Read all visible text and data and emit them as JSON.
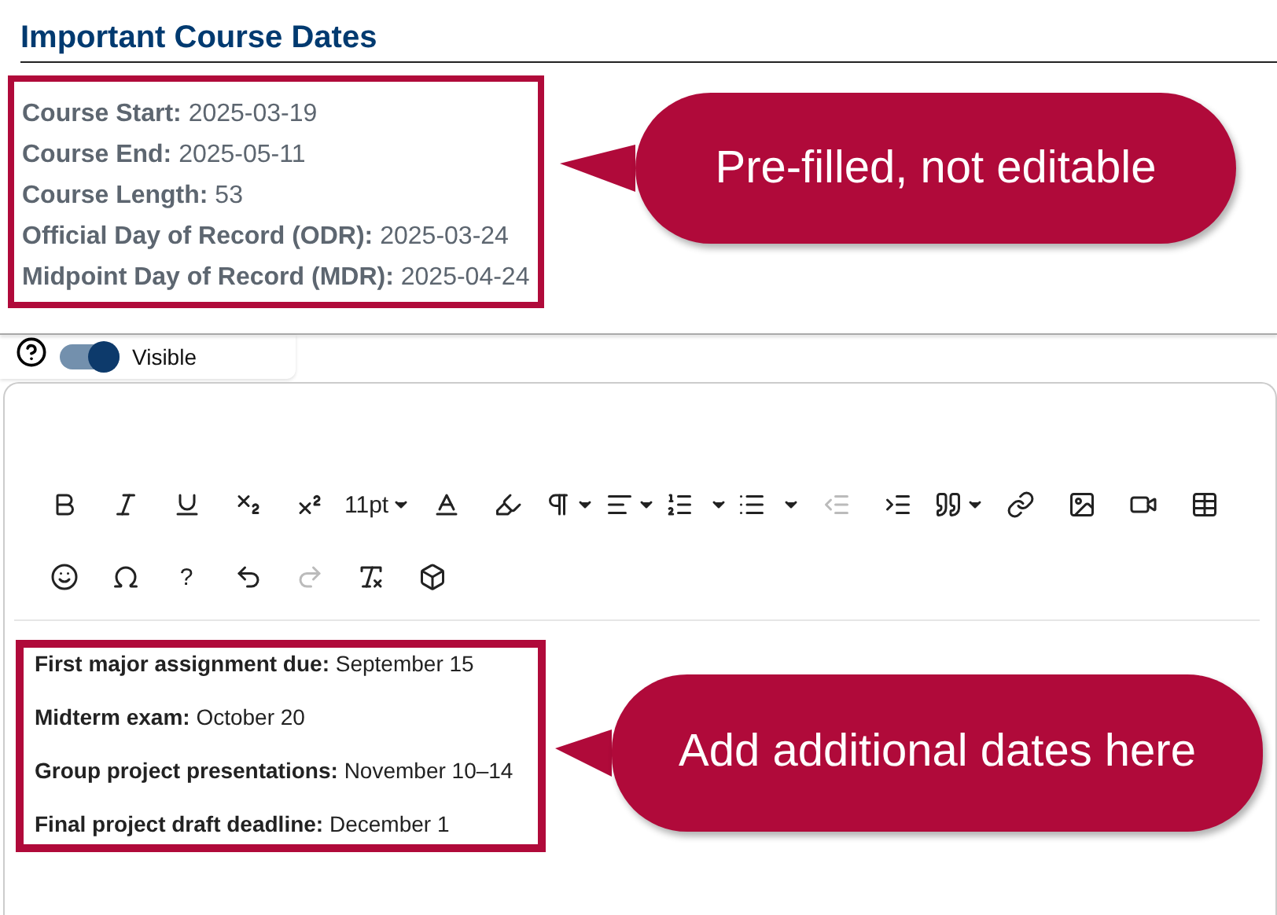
{
  "heading": "Important Course Dates",
  "course_dates": [
    {
      "label": "Course Start:",
      "value": "2025-03-19"
    },
    {
      "label": "Course End:",
      "value": "2025-05-11"
    },
    {
      "label": "Course Length:",
      "value": "53"
    },
    {
      "label": "Official Day of Record (ODR):",
      "value": "2025-03-24"
    },
    {
      "label": "Midpoint Day of Record (MDR):",
      "value": "2025-04-24"
    }
  ],
  "callout_top": "Pre-filled, not editable",
  "visibility": {
    "on": true,
    "label": "Visible"
  },
  "toolbar_rows": [
    [
      {
        "kind": "icon",
        "disabled": false
      },
      {
        "kind": "icon",
        "disabled": false
      },
      {
        "kind": "icon",
        "disabled": false
      },
      {
        "kind": "icon",
        "disabled": false
      },
      {
        "kind": "icon",
        "disabled": false
      },
      {
        "kind": "text-dropdown",
        "label": "11pt",
        "disabled": false
      },
      {
        "kind": "icon",
        "disabled": false
      },
      {
        "kind": "icon",
        "disabled": false
      },
      {
        "kind": "icon-dropdown",
        "disabled": false
      },
      {
        "kind": "icon-dropdown",
        "disabled": false
      },
      {
        "kind": "icon-split",
        "disabled": false
      },
      {
        "kind": "icon-split",
        "disabled": false
      },
      {
        "kind": "icon",
        "disabled": true
      },
      {
        "kind": "icon",
        "disabled": false
      },
      {
        "kind": "icon-dropdown",
        "disabled": false
      },
      {
        "kind": "icon",
        "disabled": false
      },
      {
        "kind": "icon",
        "disabled": false
      },
      {
        "kind": "icon",
        "disabled": false
      },
      {
        "kind": "icon",
        "disabled": false
      }
    ],
    [
      {
        "kind": "icon",
        "disabled": false
      },
      {
        "kind": "icon",
        "disabled": false
      },
      {
        "kind": "text",
        "label": "?",
        "disabled": false
      },
      {
        "kind": "icon",
        "disabled": false
      },
      {
        "kind": "icon",
        "disabled": true
      },
      {
        "kind": "icon",
        "disabled": false
      },
      {
        "kind": "icon",
        "disabled": false
      }
    ]
  ],
  "additional_dates": [
    {
      "label": "First major assignment due:",
      "value": "September 15"
    },
    {
      "label": "Midterm exam:",
      "value": "October 20"
    },
    {
      "label": "Group project presentations:",
      "value": "November 10–14"
    },
    {
      "label": "Final project draft deadline:",
      "value": "December 1"
    }
  ],
  "callout_bottom": "Add additional dates here"
}
